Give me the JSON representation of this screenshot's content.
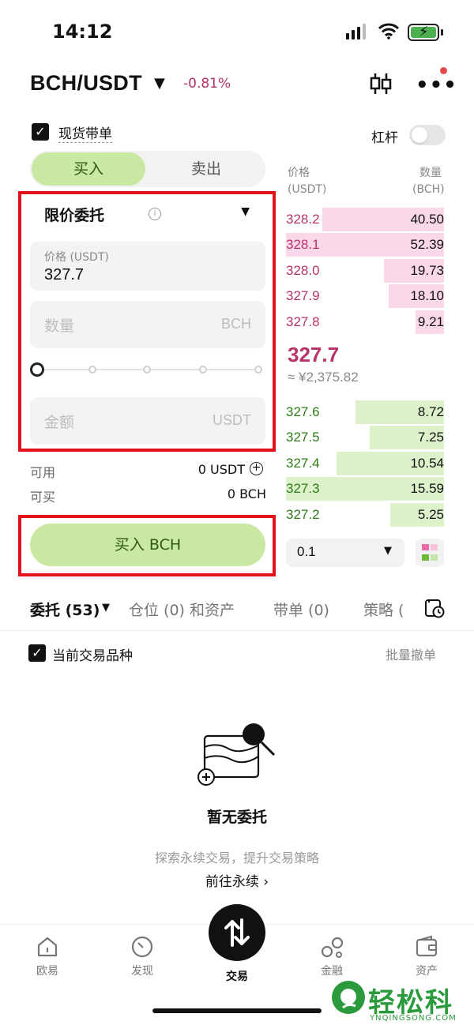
{
  "status_bar": {
    "time": "14:12"
  },
  "header": {
    "pair": "BCH/USDT",
    "change": "-0.81%"
  },
  "options": {
    "spot_tp_sl": "现货带单",
    "leverage": "杠杆"
  },
  "side_tabs": {
    "buy": "买入",
    "sell": "卖出"
  },
  "form": {
    "order_type": "限价委托",
    "price_label": "价格 (USDT)",
    "price_value": "327.7",
    "qty_placeholder": "数量",
    "qty_unit": "BCH",
    "amount_placeholder": "金额",
    "amount_unit": "USDT",
    "slider_percent": 0,
    "available_label": "可用",
    "available_value": "0 USDT",
    "can_buy_label": "可买",
    "can_buy_value": "0 BCH",
    "buy_button": "买入 BCH"
  },
  "order_book": {
    "price_header": "价格",
    "price_unit": "(USDT)",
    "qty_header": "数量",
    "qty_unit": "(BCH)",
    "asks": [
      {
        "price": "328.2",
        "qty": "40.50",
        "depth": 0.77
      },
      {
        "price": "328.1",
        "qty": "52.39",
        "depth": 1.0
      },
      {
        "price": "328.0",
        "qty": "19.73",
        "depth": 0.38
      },
      {
        "price": "327.9",
        "qty": "18.10",
        "depth": 0.35
      },
      {
        "price": "327.8",
        "qty": "9.21",
        "depth": 0.18
      }
    ],
    "last_price": "327.7",
    "last_price_cny": "≈ ¥2,375.82",
    "bids": [
      {
        "price": "327.6",
        "qty": "8.72",
        "depth": 0.56
      },
      {
        "price": "327.5",
        "qty": "7.25",
        "depth": 0.47
      },
      {
        "price": "327.4",
        "qty": "10.54",
        "depth": 0.68
      },
      {
        "price": "327.3",
        "qty": "15.59",
        "depth": 1.0
      },
      {
        "price": "327.2",
        "qty": "5.25",
        "depth": 0.34
      }
    ],
    "depth_precision": "0.1"
  },
  "lower_tabs": [
    {
      "label": "委托 (53)",
      "active": true
    },
    {
      "label": "仓位 (0) 和资产",
      "active": false
    },
    {
      "label": "带单 (0)",
      "active": false
    },
    {
      "label": "策略 (",
      "active": false
    }
  ],
  "orders": {
    "current_pair_label": "当前交易品种",
    "batch_cancel": "批量撤单",
    "empty_title": "暂无委托",
    "empty_subtitle": "探索永续交易，提升交易策略",
    "empty_link": "前往永续 ›"
  },
  "bottom_nav": [
    {
      "label": "欧易",
      "icon": "home-icon"
    },
    {
      "label": "发现",
      "icon": "discover-icon"
    },
    {
      "label": "交易",
      "icon": "trade-icon"
    },
    {
      "label": "金融",
      "icon": "finance-icon"
    },
    {
      "label": "资产",
      "icon": "wallet-icon"
    }
  ],
  "watermark": {
    "text": "轻松科技",
    "sub": "YNQINGSONG.COM"
  },
  "colors": {
    "buy_green": "#c9e8a2",
    "sell_pink": "#b8336a",
    "highlight_red": "#e3121a"
  }
}
